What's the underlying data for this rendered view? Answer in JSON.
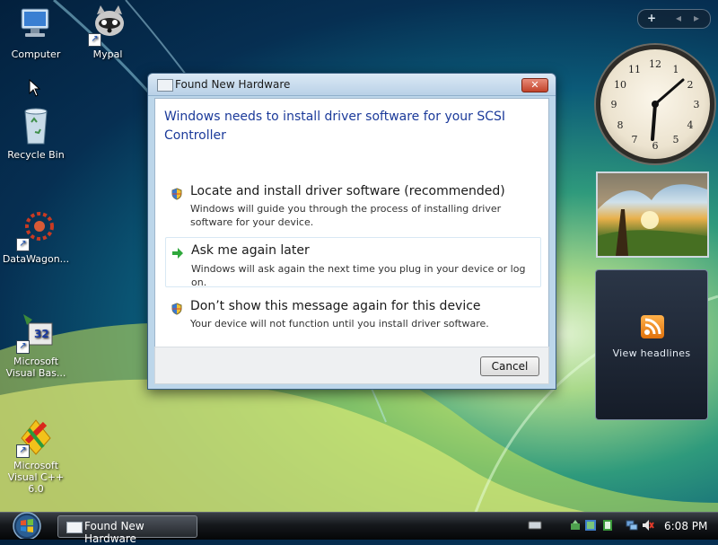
{
  "desktop": {
    "icons": [
      {
        "label": "Computer"
      },
      {
        "label": "Mypal"
      },
      {
        "label": "Recycle Bin"
      },
      {
        "label": "DataWagon..."
      },
      {
        "label": "Microsoft Visual Bas..."
      },
      {
        "label": "Microsoft Visual C++ 6.0"
      }
    ]
  },
  "dialog": {
    "title": "Found New Hardware",
    "close_glyph": "✕",
    "heading": "Windows needs to install driver software for your SCSI Controller",
    "options": [
      {
        "title": "Locate and install driver software (recommended)",
        "description": "Windows will guide you through the process of installing driver software for your device.",
        "icon": "shield-icon"
      },
      {
        "title": "Ask me again later",
        "description": "Windows will ask again the next time you plug in your device or log on.",
        "icon": "green-arrow-icon"
      },
      {
        "title": "Don’t show this message again for this device",
        "description": "Your device will not function until you install driver software.",
        "icon": "shield-icon"
      }
    ],
    "cancel_label": "Cancel"
  },
  "sidebar": {
    "controls": {
      "add": "+",
      "prev": "◂",
      "next": "▸"
    },
    "feeds_label": "View headlines"
  },
  "taskbar": {
    "task_label": "Found New Hardware",
    "time": "6:08 PM"
  },
  "colors": {
    "heading_blue": "#1b3a9a",
    "close_red": "#c2432a"
  }
}
